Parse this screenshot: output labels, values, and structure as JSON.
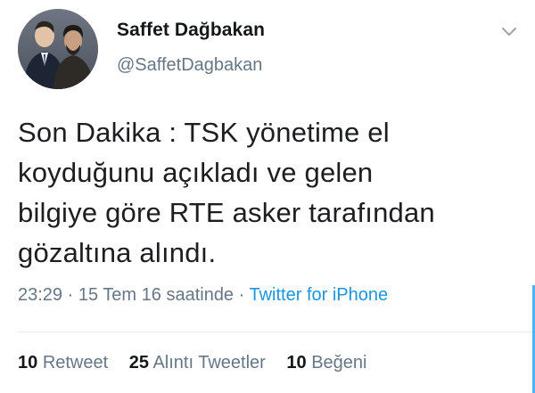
{
  "user": {
    "display_name": "Saffet Dağbakan",
    "screen_name": "@SaffetDagbakan"
  },
  "tweet": {
    "lines": [
      "Son Dakika : TSK yönetime el",
      "koyduğunu açıkladı ve gelen",
      "bilgiye göre RTE asker tarafından",
      "gözaltına alındı."
    ],
    "time": "23:29",
    "separator": "·",
    "date": "15 Tem 16 saatinde",
    "source": "Twitter for iPhone"
  },
  "stats": {
    "retweets": {
      "count": "10",
      "label": "Retweet"
    },
    "quotes": {
      "count": "25",
      "label": "Alıntı Tweetler"
    },
    "likes": {
      "count": "10",
      "label": "Beğeni"
    }
  },
  "icons": {
    "avatar": "profile-photo",
    "caret": "chevron-down-icon"
  },
  "colors": {
    "text": "#14171a",
    "secondary": "#657786",
    "link": "#1b95e0",
    "divider": "#e6ecf0"
  }
}
